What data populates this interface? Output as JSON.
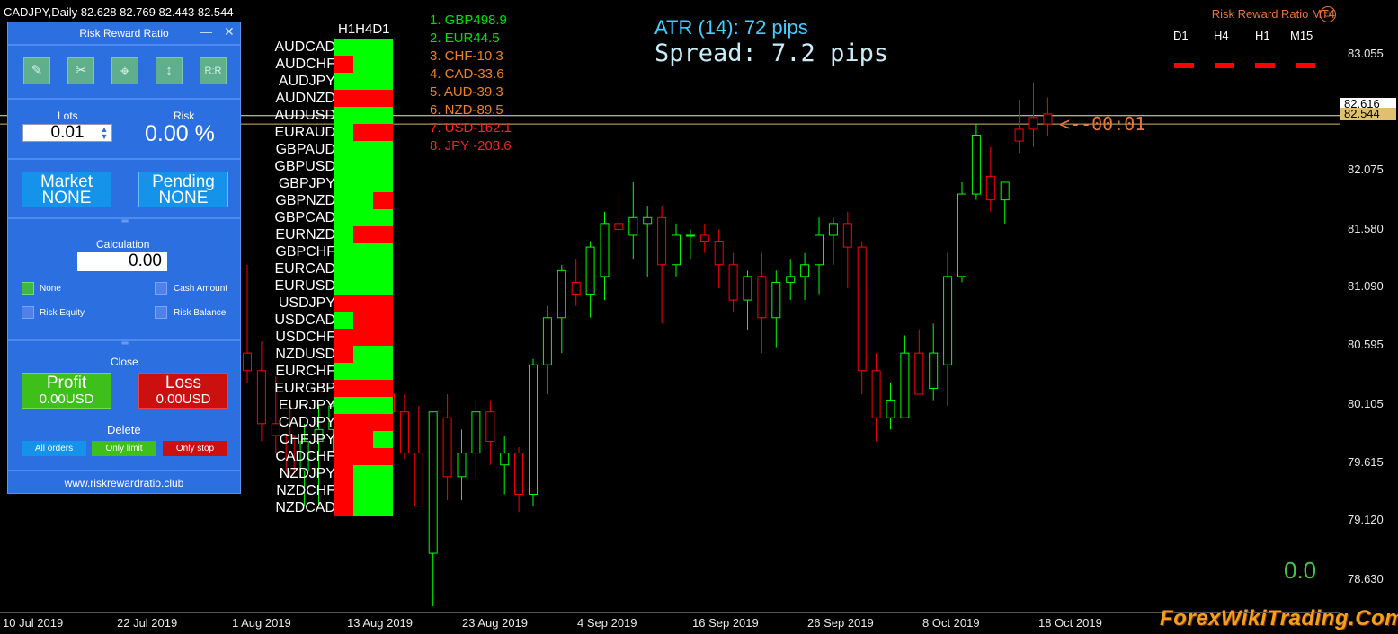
{
  "chart": {
    "symbol_line": "CADJPY,Daily  82.628 82.769 82.443 82.544",
    "indicator_title": "Risk Reward Ratio MT4",
    "timeframes": [
      "D1",
      "H4",
      "H1",
      "M15"
    ],
    "price_ticks": [
      "83.055",
      "82.075",
      "81.580",
      "81.090",
      "80.595",
      "80.105",
      "79.615",
      "79.120",
      "78.630"
    ],
    "price_box_upper": "82.616",
    "price_box_lower": "82.544",
    "time_ticks": [
      "10 Jul 2019",
      "22 Jul 2019",
      "1 Aug 2019",
      "13 Aug 2019",
      "23 Aug 2019",
      "4 Sep 2019",
      "16 Sep 2019",
      "26 Sep 2019",
      "8 Oct 2019",
      "18 Oct 2019"
    ],
    "atr_text": "ATR (14): 72 pips",
    "spread_text": "Spread: 7.2 pips",
    "countdown": "<--00:01",
    "pnl_value": "0.0",
    "watermark": "ForexWikiTrading.Com",
    "colors": {
      "up": "#00ff00",
      "down": "#ff0000",
      "axis_text": "#e8e8e8",
      "accent": "#e8763a"
    },
    "candles": [
      [
        80.6,
        81.35,
        80.35,
        80.45
      ],
      [
        80.45,
        80.7,
        79.85,
        80.0
      ],
      [
        80.0,
        80.4,
        79.75,
        79.9
      ],
      [
        79.9,
        80.2,
        79.55,
        79.6
      ],
      [
        79.6,
        80.0,
        79.3,
        79.85
      ],
      [
        79.85,
        80.15,
        79.3,
        79.95
      ],
      [
        79.95,
        80.2,
        79.75,
        80.15
      ],
      [
        80.15,
        80.35,
        80.0,
        80.1
      ],
      [
        80.1,
        80.2,
        79.7,
        79.8
      ],
      [
        79.8,
        80.25,
        79.65,
        80.25
      ],
      [
        80.25,
        80.3,
        79.95,
        80.1
      ],
      [
        80.1,
        80.25,
        79.7,
        79.75
      ],
      [
        79.75,
        80.15,
        79.3,
        79.3
      ],
      [
        78.9,
        80.1,
        78.45,
        80.1
      ],
      [
        80.05,
        80.25,
        79.35,
        79.55
      ],
      [
        79.55,
        79.95,
        79.35,
        79.75
      ],
      [
        79.75,
        80.2,
        79.55,
        80.1
      ],
      [
        80.1,
        80.2,
        79.65,
        79.85
      ],
      [
        79.65,
        79.9,
        79.4,
        79.75
      ],
      [
        79.75,
        79.8,
        79.25,
        79.4
      ],
      [
        79.4,
        80.55,
        79.3,
        80.5
      ],
      [
        80.5,
        81.0,
        80.25,
        80.9
      ],
      [
        80.9,
        81.35,
        80.6,
        81.3
      ],
      [
        81.2,
        81.4,
        81.0,
        81.1
      ],
      [
        81.1,
        81.55,
        80.9,
        81.5
      ],
      [
        81.25,
        81.8,
        81.05,
        81.7
      ],
      [
        81.7,
        81.95,
        81.3,
        81.65
      ],
      [
        81.6,
        82.05,
        81.4,
        81.75
      ],
      [
        81.7,
        81.85,
        81.25,
        81.75
      ],
      [
        81.75,
        81.85,
        80.85,
        81.35
      ],
      [
        81.35,
        81.7,
        81.25,
        81.6
      ],
      [
        81.6,
        81.65,
        81.4,
        81.6
      ],
      [
        81.6,
        81.7,
        81.45,
        81.55
      ],
      [
        81.55,
        81.65,
        81.15,
        81.35
      ],
      [
        81.35,
        81.45,
        80.95,
        81.05
      ],
      [
        81.05,
        81.3,
        80.8,
        81.25
      ],
      [
        81.25,
        81.45,
        80.6,
        80.9
      ],
      [
        80.9,
        81.3,
        80.65,
        81.2
      ],
      [
        81.2,
        81.4,
        81.05,
        81.25
      ],
      [
        81.25,
        81.45,
        81.05,
        81.35
      ],
      [
        81.35,
        81.75,
        81.1,
        81.6
      ],
      [
        81.6,
        81.75,
        81.35,
        81.7
      ],
      [
        81.7,
        81.8,
        81.15,
        81.5
      ],
      [
        81.5,
        81.55,
        80.25,
        80.45
      ],
      [
        80.45,
        80.6,
        79.85,
        80.05
      ],
      [
        80.05,
        80.35,
        79.95,
        80.2
      ],
      [
        80.05,
        80.75,
        80.05,
        80.6
      ],
      [
        80.6,
        80.8,
        80.25,
        80.25
      ],
      [
        80.3,
        80.85,
        80.2,
        80.6
      ],
      [
        80.5,
        81.45,
        80.15,
        81.25
      ],
      [
        81.25,
        82.05,
        81.2,
        81.95
      ],
      [
        81.95,
        82.55,
        81.9,
        82.45
      ],
      [
        82.1,
        82.35,
        81.8,
        81.9
      ],
      [
        81.9,
        82.05,
        81.7,
        82.05
      ],
      [
        82.5,
        82.75,
        82.3,
        82.4
      ],
      [
        82.6,
        82.9,
        82.35,
        82.5
      ],
      [
        82.63,
        82.77,
        82.44,
        82.545
      ]
    ]
  },
  "strength": [
    {
      "text": "1. GBP498.9",
      "color": "#00e000"
    },
    {
      "text": "2. EUR44.5",
      "color": "#00e000"
    },
    {
      "text": "3. CHF-10.3",
      "color": "#f08020"
    },
    {
      "text": "4. CAD-33.6",
      "color": "#f08020"
    },
    {
      "text": "5. AUD-39.3",
      "color": "#f08020"
    },
    {
      "text": "6. NZD-89.5",
      "color": "#f08020"
    },
    {
      "text": "7. USD-162.1",
      "color": "#ff2020"
    },
    {
      "text": "8. JPY -208.6",
      "color": "#ff2020"
    }
  ],
  "matrix": {
    "header": "H1H4D1",
    "rows": [
      {
        "pair": "AUDCAD",
        "cells": [
          "up",
          "up",
          "up"
        ]
      },
      {
        "pair": "AUDCHF",
        "cells": [
          "down",
          "up",
          "up"
        ]
      },
      {
        "pair": "AUDJPY",
        "cells": [
          "up",
          "up",
          "up"
        ]
      },
      {
        "pair": "AUDNZD",
        "cells": [
          "down",
          "down",
          "down"
        ]
      },
      {
        "pair": "AUDUSD",
        "cells": [
          "up",
          "up",
          "up"
        ]
      },
      {
        "pair": "EURAUD",
        "cells": [
          "up",
          "down",
          "down"
        ]
      },
      {
        "pair": "GBPAUD",
        "cells": [
          "up",
          "up",
          "up"
        ]
      },
      {
        "pair": "GBPUSD",
        "cells": [
          "up",
          "up",
          "up"
        ]
      },
      {
        "pair": "GBPJPY",
        "cells": [
          "up",
          "up",
          "up"
        ]
      },
      {
        "pair": "GBPNZD",
        "cells": [
          "up",
          "up",
          "down"
        ]
      },
      {
        "pair": "GBPCAD",
        "cells": [
          "up",
          "up",
          "up"
        ]
      },
      {
        "pair": "EURNZD",
        "cells": [
          "up",
          "down",
          "down"
        ]
      },
      {
        "pair": "GBPCHF",
        "cells": [
          "up",
          "up",
          "up"
        ]
      },
      {
        "pair": "EURCAD",
        "cells": [
          "up",
          "up",
          "up"
        ]
      },
      {
        "pair": "EURUSD",
        "cells": [
          "up",
          "up",
          "up"
        ]
      },
      {
        "pair": "USDJPY",
        "cells": [
          "down",
          "down",
          "down"
        ]
      },
      {
        "pair": "USDCAD",
        "cells": [
          "up",
          "down",
          "down"
        ]
      },
      {
        "pair": "USDCHF",
        "cells": [
          "down",
          "down",
          "down"
        ]
      },
      {
        "pair": "NZDUSD",
        "cells": [
          "down",
          "up",
          "up"
        ]
      },
      {
        "pair": "EURCHF",
        "cells": [
          "up",
          "up",
          "up"
        ]
      },
      {
        "pair": "EURGBP",
        "cells": [
          "down",
          "down",
          "down"
        ]
      },
      {
        "pair": "EURJPY",
        "cells": [
          "up",
          "up",
          "up"
        ]
      },
      {
        "pair": "CADJPY",
        "cells": [
          "down",
          "down",
          "down"
        ]
      },
      {
        "pair": "CHFJPY",
        "cells": [
          "down",
          "down",
          "up"
        ]
      },
      {
        "pair": "CADCHF",
        "cells": [
          "down",
          "down",
          "down"
        ]
      },
      {
        "pair": "NZDJPY",
        "cells": [
          "down",
          "up",
          "up"
        ]
      },
      {
        "pair": "NZDCHF",
        "cells": [
          "down",
          "up",
          "up"
        ]
      },
      {
        "pair": "NZDCAD",
        "cells": [
          "down",
          "up",
          "up"
        ]
      }
    ]
  },
  "panel": {
    "title": "Risk Reward Ratio",
    "minimize": "—",
    "close": "✕",
    "tools": [
      {
        "icon": "pencil-icon",
        "glyph": "✎"
      },
      {
        "icon": "scissors-icon",
        "glyph": "✂"
      },
      {
        "icon": "crosshair-icon",
        "glyph": "⌖"
      },
      {
        "icon": "vertical-arrows-icon",
        "glyph": "↕"
      },
      {
        "icon": "rr-icon",
        "glyph": "R:R"
      }
    ],
    "lots_label": "Lots",
    "lots_value": "0.01",
    "risk_label": "Risk",
    "risk_value": "0.00 %",
    "market_label": "Market",
    "market_value": "NONE",
    "pending_label": "Pending",
    "pending_value": "NONE",
    "calculation_label": "Calculation",
    "calculation_value": "0.00",
    "options": {
      "none": "None",
      "cash_amount": "Cash Amount",
      "risk_equity": "Risk Equity",
      "risk_balance": "Risk Balance"
    },
    "close_label": "Close",
    "profit_label": "Profit",
    "profit_value": "0.00USD",
    "loss_label": "Loss",
    "loss_value": "0.00USD",
    "delete_label": "Delete",
    "all_orders": "All orders",
    "only_limit": "Only limit",
    "only_stop": "Only stop",
    "footer": "www.riskrewardratio.club",
    "colors": {
      "panel": "#2c6fe0",
      "market": "#1592ea",
      "profit": "#3fbf1a",
      "loss": "#cc1010",
      "all_orders": "#1592ea",
      "only_limit": "#3fbf1a",
      "only_stop": "#cc1010"
    }
  }
}
